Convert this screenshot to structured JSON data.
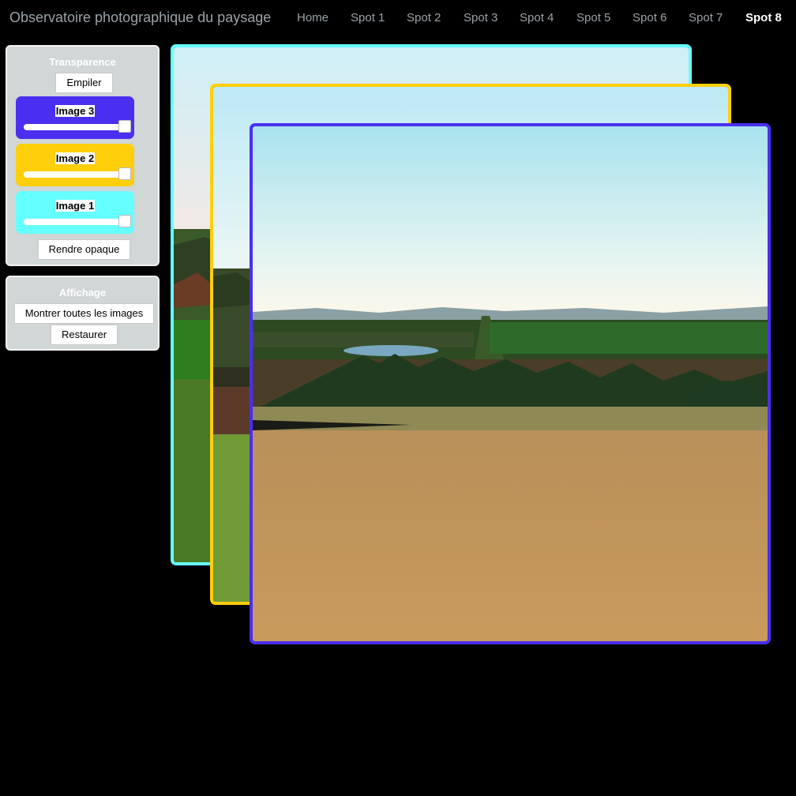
{
  "app": {
    "title": "Observatoire photographique du paysage"
  },
  "nav": {
    "items": [
      {
        "label": "Home",
        "active": false
      },
      {
        "label": "Spot 1",
        "active": false
      },
      {
        "label": "Spot 2",
        "active": false
      },
      {
        "label": "Spot 3",
        "active": false
      },
      {
        "label": "Spot 4",
        "active": false
      },
      {
        "label": "Spot 5",
        "active": false
      },
      {
        "label": "Spot 6",
        "active": false
      },
      {
        "label": "Spot 7",
        "active": false
      },
      {
        "label": "Spot 8",
        "active": true
      }
    ]
  },
  "transparence": {
    "title": "Transparence",
    "stack_button": "Empiler",
    "layers": [
      {
        "label": "Image 3",
        "color": "#4a2ff0",
        "opacity": 1.0
      },
      {
        "label": "Image 2",
        "color": "#ffcf0b",
        "opacity": 1.0
      },
      {
        "label": "Image 1",
        "color": "#66ffff",
        "opacity": 1.0
      }
    ],
    "opaque_button": "Rendre opaque"
  },
  "affichage": {
    "title": "Affichage",
    "show_all_button": "Montrer toutes les images",
    "restore_button": "Restaurer"
  },
  "colors": {
    "image1": "#66ffff",
    "image2": "#ffcf0b",
    "image3": "#4a2ff0",
    "nav_text": "#9aa3a8",
    "panel_bg": "#d1d6d7"
  }
}
